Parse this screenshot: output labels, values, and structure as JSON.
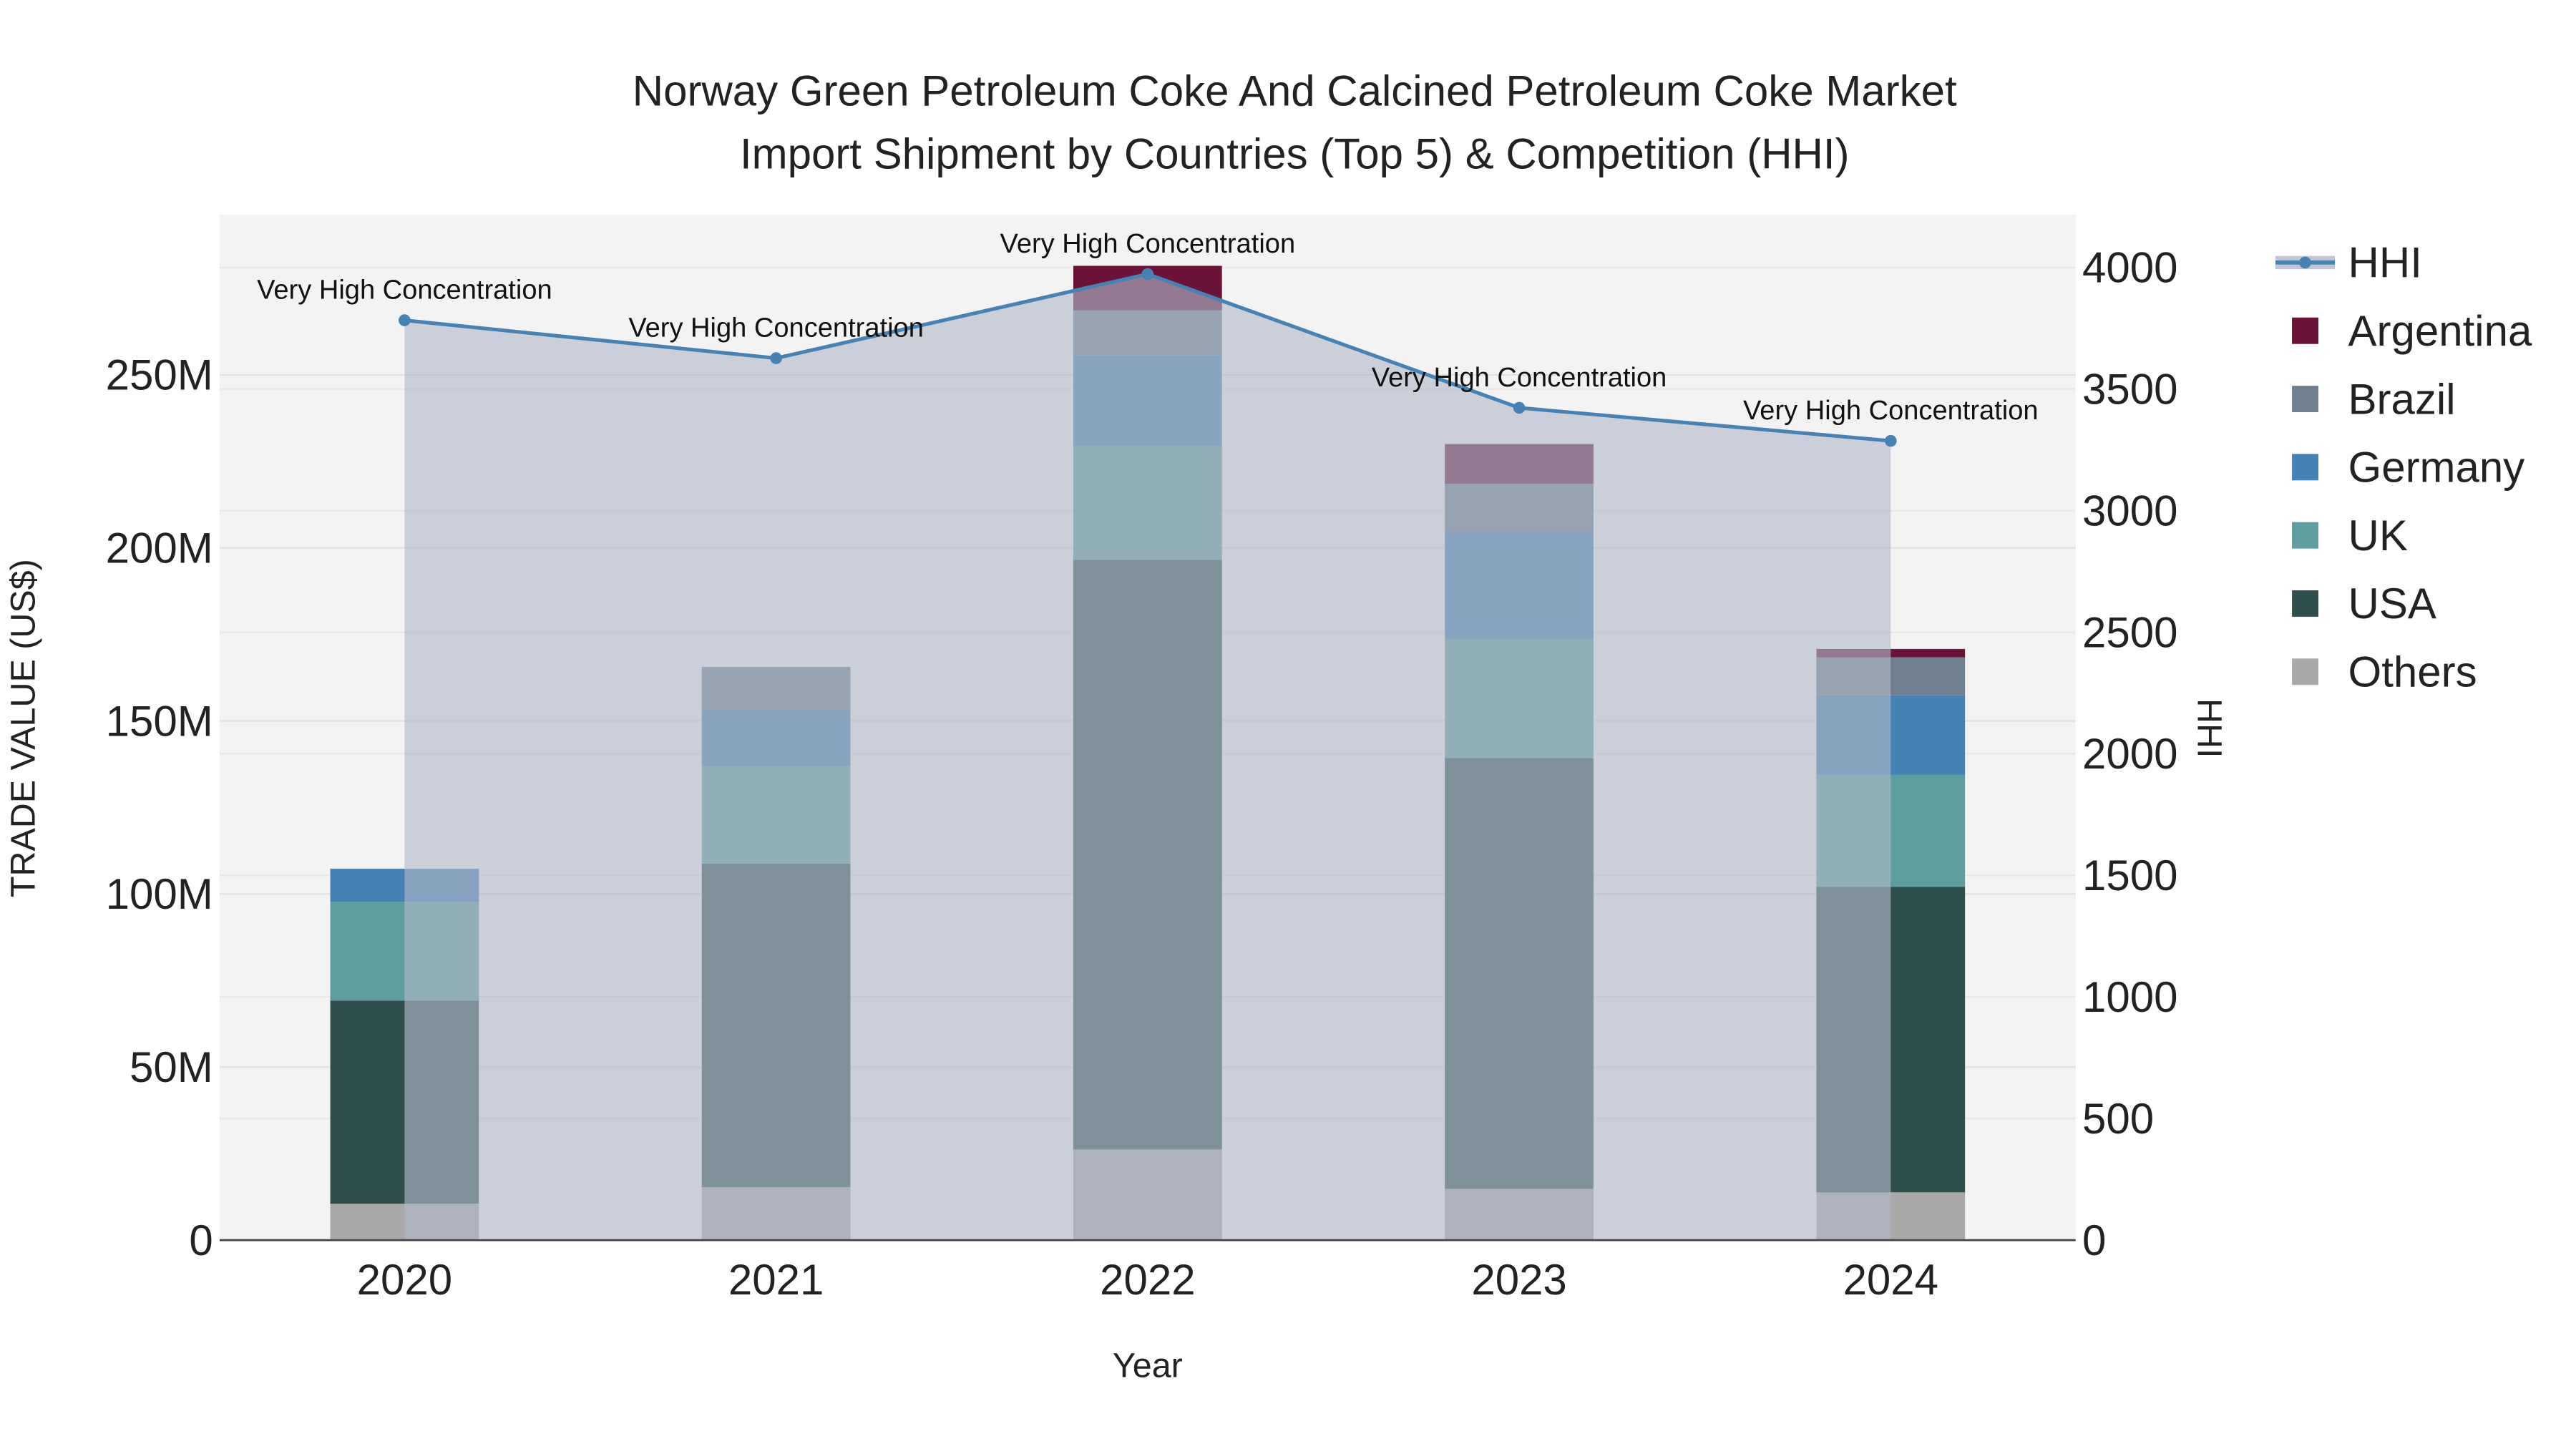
{
  "chart_data": {
    "type": "bar",
    "title_line1": "Norway Green Petroleum Coke And Calcined Petroleum Coke Market",
    "title_line2": "Import Shipment by Countries (Top 5) & Competition (HHI)",
    "xlabel": "Year",
    "ylabel": "TRADE VALUE (US$)",
    "y2label": "HHI",
    "categories": [
      "2020",
      "2021",
      "2022",
      "2023",
      "2024"
    ],
    "ylim": [
      0,
      290
    ],
    "y_ticks": [
      0,
      50,
      100,
      150,
      200,
      250
    ],
    "y_tick_labels": [
      "0",
      "50M",
      "100M",
      "150M",
      "200M",
      "250M"
    ],
    "y2lim": [
      0,
      4220
    ],
    "y2_ticks": [
      0,
      500,
      1000,
      1500,
      2000,
      2500,
      3000,
      3500,
      4000
    ],
    "y2_tick_labels": [
      "0",
      "500",
      "1000",
      "1500",
      "2000",
      "2500",
      "3000",
      "3500",
      "4000"
    ],
    "stack_series": [
      {
        "name": "Others",
        "color": "#a9a9a9",
        "values": [
          10.5,
          15.3,
          26.2,
          14.8,
          13.8
        ]
      },
      {
        "name": "USA",
        "color": "#2f4f4f",
        "values": [
          58.7,
          93.5,
          170.4,
          124.5,
          88.3
        ]
      },
      {
        "name": "UK",
        "color": "#5f9ea0",
        "values": [
          28.6,
          28.1,
          32.9,
          34.4,
          32.4
        ]
      },
      {
        "name": "Germany",
        "color": "#4682b4",
        "values": [
          9.5,
          16.2,
          26.2,
          31.0,
          22.9
        ]
      },
      {
        "name": "Brazil",
        "color": "#708090",
        "values": [
          0,
          12.5,
          12.9,
          13.8,
          11.0
        ]
      },
      {
        "name": "Argentina",
        "color": "#6b1239",
        "values": [
          0,
          0,
          12.9,
          11.5,
          2.4
        ]
      }
    ],
    "line_series": {
      "name": "HHI",
      "color": "#4682b4",
      "values": [
        3783,
        3627,
        3973,
        3423,
        3287
      ]
    },
    "annotations": [
      "Very High Concentration",
      "Very High Concentration",
      "Very High Concentration",
      "Very High Concentration",
      "Very High Concentration"
    ],
    "legend": [
      "HHI",
      "Argentina",
      "Brazil",
      "Germany",
      "UK",
      "USA",
      "Others"
    ],
    "legend_placement": "right",
    "grid": true
  }
}
